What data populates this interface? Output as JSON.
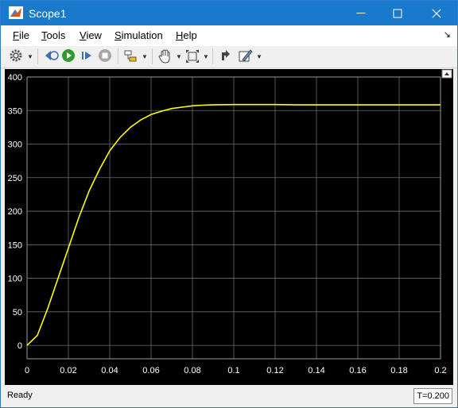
{
  "window": {
    "title": "Scope1"
  },
  "menu": {
    "file": "ile",
    "file_key": "F",
    "tools": "ools",
    "tools_key": "T",
    "view": "iew",
    "view_key": "V",
    "simulation": "imulation",
    "simulation_key": "S",
    "help": "elp",
    "help_key": "H"
  },
  "toolbar": {
    "icons": [
      "gear-icon",
      "step-back-icon",
      "run-icon",
      "step-forward-icon",
      "stop-icon",
      "highlight-block-icon",
      "zoom-pan-icon",
      "autoscale-icon",
      "restore-icon",
      "style-icon"
    ]
  },
  "status": {
    "text": "Ready",
    "time": "T=0.200"
  },
  "chart_data": {
    "type": "line",
    "title": "",
    "xlabel": "",
    "ylabel": "",
    "xlim": [
      0,
      0.2
    ],
    "ylim": [
      -20,
      400
    ],
    "grid": true,
    "xticks": [
      "0",
      "0.02",
      "0.04",
      "0.06",
      "0.08",
      "0.1",
      "0.12",
      "0.14",
      "0.16",
      "0.18",
      "0.2"
    ],
    "yticks": [
      "0",
      "50",
      "100",
      "150",
      "200",
      "250",
      "300",
      "350",
      "400"
    ],
    "series": [
      {
        "color": "#ffff00",
        "x": [
          0,
          0.005,
          0.01,
          0.015,
          0.02,
          0.025,
          0.03,
          0.035,
          0.04,
          0.045,
          0.05,
          0.055,
          0.06,
          0.065,
          0.07,
          0.075,
          0.08,
          0.085,
          0.09,
          0.1,
          0.11,
          0.12,
          0.13,
          0.14,
          0.15,
          0.16,
          0.17,
          0.18,
          0.19,
          0.2
        ],
        "values": [
          0,
          15,
          55,
          100,
          145,
          190,
          230,
          262,
          290,
          310,
          325,
          336,
          344,
          349,
          353,
          355,
          357,
          358,
          358.5,
          359,
          359,
          359,
          358.5,
          358.5,
          358.5,
          358.5,
          358.5,
          358.5,
          358.5,
          358.5
        ]
      }
    ]
  }
}
